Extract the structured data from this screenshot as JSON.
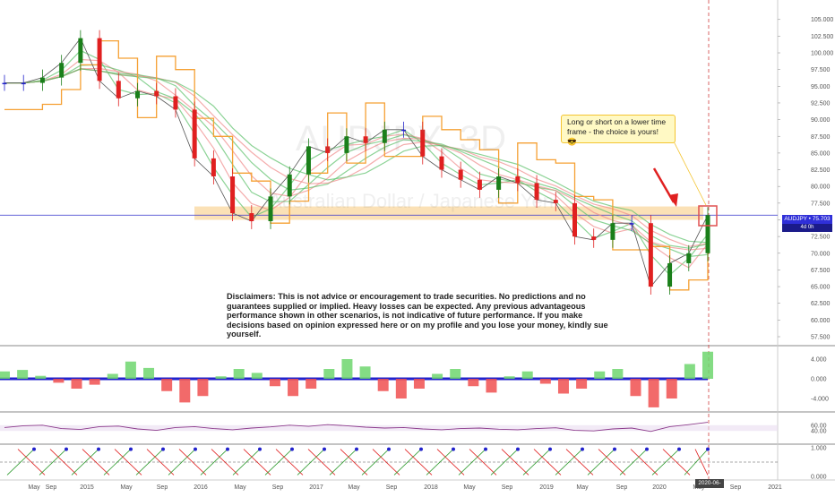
{
  "chart_data": [
    {
      "type": "line",
      "title": "AUDJPY, 3D",
      "subtitle": "Australian Dollar / Japanese Yen",
      "x": [
        "2014-07",
        "2014-09",
        "2014-11",
        "2015-01",
        "2015-03",
        "2015-05",
        "2015-07",
        "2015-09",
        "2015-11",
        "2016-01",
        "2016-03",
        "2016-05",
        "2016-07",
        "2016-09",
        "2016-11",
        "2017-01",
        "2017-03",
        "2017-05",
        "2017-07",
        "2017-09",
        "2017-11",
        "2018-01",
        "2018-03",
        "2018-05",
        "2018-07",
        "2018-09",
        "2018-11",
        "2019-01",
        "2019-03",
        "2019-05",
        "2019-07",
        "2019-09",
        "2019-11",
        "2020-01",
        "2020-03",
        "2020-04",
        "2020-05",
        "2020-06"
      ],
      "series": [
        {
          "values": [
            95.5,
            95.5,
            96.3,
            98.5,
            102.2,
            95.8,
            93.2,
            94.3,
            93.5,
            91.5,
            84.2,
            81.5,
            76.0,
            74.8,
            78.5,
            81.8,
            86.0,
            85.0,
            87.5,
            86.5,
            88.5,
            88.5,
            84.5,
            82.5,
            81.0,
            79.5,
            81.5,
            80.5,
            78.0,
            77.5,
            72.5,
            72.0,
            74.5,
            74.5,
            65.0,
            68.5,
            70.0,
            75.7
          ]
        }
      ],
      "ylim": [
        57.5,
        105.5
      ],
      "yticks": [
        "105.000",
        "102.500",
        "100.000",
        "97.500",
        "95.000",
        "92.500",
        "90.000",
        "87.500",
        "85.000",
        "82.500",
        "80.000",
        "77.500",
        "75.000",
        "72.500",
        "70.000",
        "67.500",
        "65.000",
        "62.500",
        "60.000",
        "57.500"
      ],
      "xticks": [
        "May",
        "Sep",
        "2015",
        "May",
        "Sep",
        "2016",
        "May",
        "Sep",
        "2017",
        "May",
        "Sep",
        "2018",
        "May",
        "Sep",
        "2019",
        "May",
        "Sep",
        "2020",
        "May",
        "Sep",
        "2021"
      ],
      "last_price_label": "AUDJPY • 75.703",
      "time_label": "4d 0h",
      "date_label": "2020-06-04",
      "resistance_zone": [
        75.0,
        77.0
      ],
      "grid": false
    },
    {
      "type": "bar",
      "ylim": [
        -6,
        6
      ],
      "yticks": [
        "4.000",
        "0.000",
        "-4.000"
      ],
      "values": [
        1.5,
        1.8,
        0.6,
        -0.8,
        -2.0,
        -1.2,
        1.0,
        3.5,
        2.2,
        -2.5,
        -4.8,
        -3.5,
        0.5,
        2.0,
        1.2,
        -1.5,
        -3.5,
        -2.0,
        2.0,
        4.0,
        2.5,
        -2.5,
        -4.0,
        -2.0,
        1.0,
        2.0,
        -1.5,
        -2.8,
        0.5,
        1.5,
        -1.0,
        -3.0,
        -2.0,
        1.5,
        2.0,
        -3.5,
        -5.8,
        -4.0,
        3.0,
        5.5
      ]
    },
    {
      "type": "line",
      "ylim": [
        0,
        100
      ],
      "yticks": [
        "60.00",
        "40.00"
      ],
      "values": [
        52,
        58,
        60,
        48,
        45,
        55,
        57,
        47,
        42,
        52,
        55,
        48,
        44,
        50,
        54,
        60,
        56,
        62,
        58,
        53,
        50,
        52,
        47,
        44,
        48,
        50,
        46,
        44,
        48,
        51,
        42,
        40,
        47,
        50,
        38,
        55,
        62,
        70
      ]
    },
    {
      "type": "line",
      "ylim": [
        0,
        1
      ],
      "yticks": [
        "1.000",
        "0.000"
      ]
    }
  ],
  "callout_text": "Long or short on a lower time frame - the choice is yours! 😎",
  "disclaimer_text": "Disclaimers: This is not advice or encouragement to trade securities. No predictions and no guarantees supplied or implied. Heavy losses can be expected. Any previous advantageous performance shown in other scenarios, is not indicative of future performance.  If you make decisions based on opinion expressed here or on my profile and you lose your money, kindly sue yourself.",
  "colors": {
    "up": "#1a7f1a",
    "down": "#e02020",
    "mid": "#2222cc",
    "supertrend": "#f5a033",
    "ribbon_green": "#5bc06a",
    "ribbon_red": "#f08a8a",
    "zone": "#f7c87a",
    "price_line": "#3333cc",
    "rsi": "#8b3a8b"
  }
}
